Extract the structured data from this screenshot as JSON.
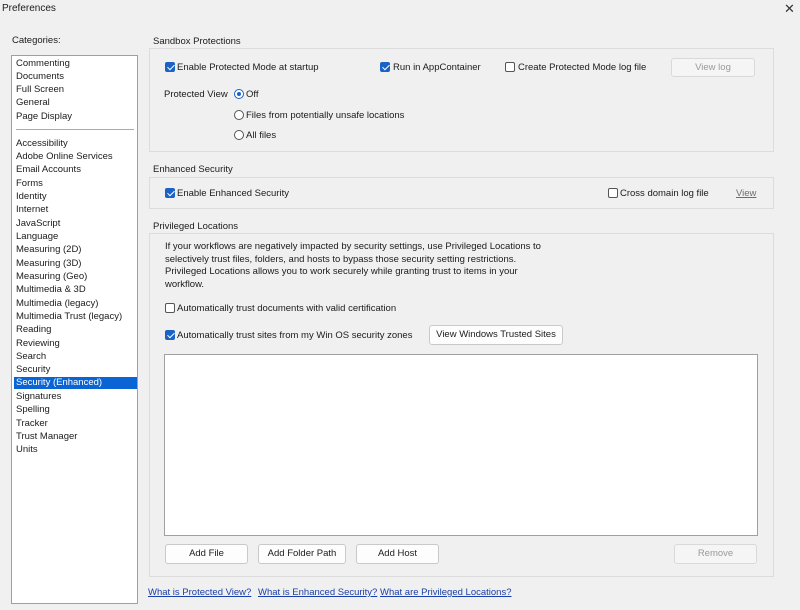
{
  "window": {
    "title": "Preferences",
    "close_glyph": "✕"
  },
  "categories": {
    "label": "Categories:",
    "group1": [
      "Commenting",
      "Documents",
      "Full Screen",
      "General",
      "Page Display"
    ],
    "group2": [
      "Accessibility",
      "Adobe Online Services",
      "Email Accounts",
      "Forms",
      "Identity",
      "Internet",
      "JavaScript",
      "Language",
      "Measuring (2D)",
      "Measuring (3D)",
      "Measuring (Geo)",
      "Multimedia & 3D",
      "Multimedia (legacy)",
      "Multimedia Trust (legacy)",
      "Reading",
      "Reviewing",
      "Search",
      "Security",
      "Security (Enhanced)",
      "Signatures",
      "Spelling",
      "Tracker",
      "Trust Manager",
      "Units"
    ],
    "selected": "Security (Enhanced)"
  },
  "sandbox": {
    "title": "Sandbox Protections",
    "protected_mode": {
      "label": "Enable Protected Mode at startup",
      "checked": true
    },
    "app_container": {
      "label": "Run in AppContainer",
      "checked": true
    },
    "log_file": {
      "label": "Create Protected Mode log file",
      "checked": false
    },
    "view_log": "View log",
    "protected_view": {
      "label": "Protected View",
      "options": [
        "Off",
        "Files from potentially unsafe locations",
        "All files"
      ],
      "selected": "Off"
    }
  },
  "enhanced": {
    "title": "Enhanced Security",
    "enable": {
      "label": "Enable Enhanced Security",
      "checked": true
    },
    "cross_domain": {
      "label": "Cross domain log file",
      "checked": false
    },
    "view": "View"
  },
  "privileged": {
    "title": "Privileged Locations",
    "description": [
      "If your workflows are negatively impacted by security settings, use Privileged Locations to",
      "selectively trust files, folders, and hosts to bypass those security setting restrictions.",
      "Privileged Locations allows you to work securely while granting trust to items in your",
      "workflow."
    ],
    "trust_cert": {
      "label": "Automatically trust documents with valid certification",
      "checked": false
    },
    "trust_sites": {
      "label": "Automatically trust sites from my Win OS security zones",
      "checked": true
    },
    "view_trusted": "View Windows Trusted Sites",
    "add_file": "Add File",
    "add_folder": "Add Folder Path",
    "add_host": "Add Host",
    "remove": "Remove"
  },
  "links": {
    "protected_view": "What is Protected View?",
    "enhanced_security": "What is Enhanced Security?",
    "privileged_locations": "What are Privileged Locations?"
  },
  "colors": {
    "accent": "#1a62c6",
    "selection": "#0a64d3",
    "link": "#1a3fa8"
  }
}
